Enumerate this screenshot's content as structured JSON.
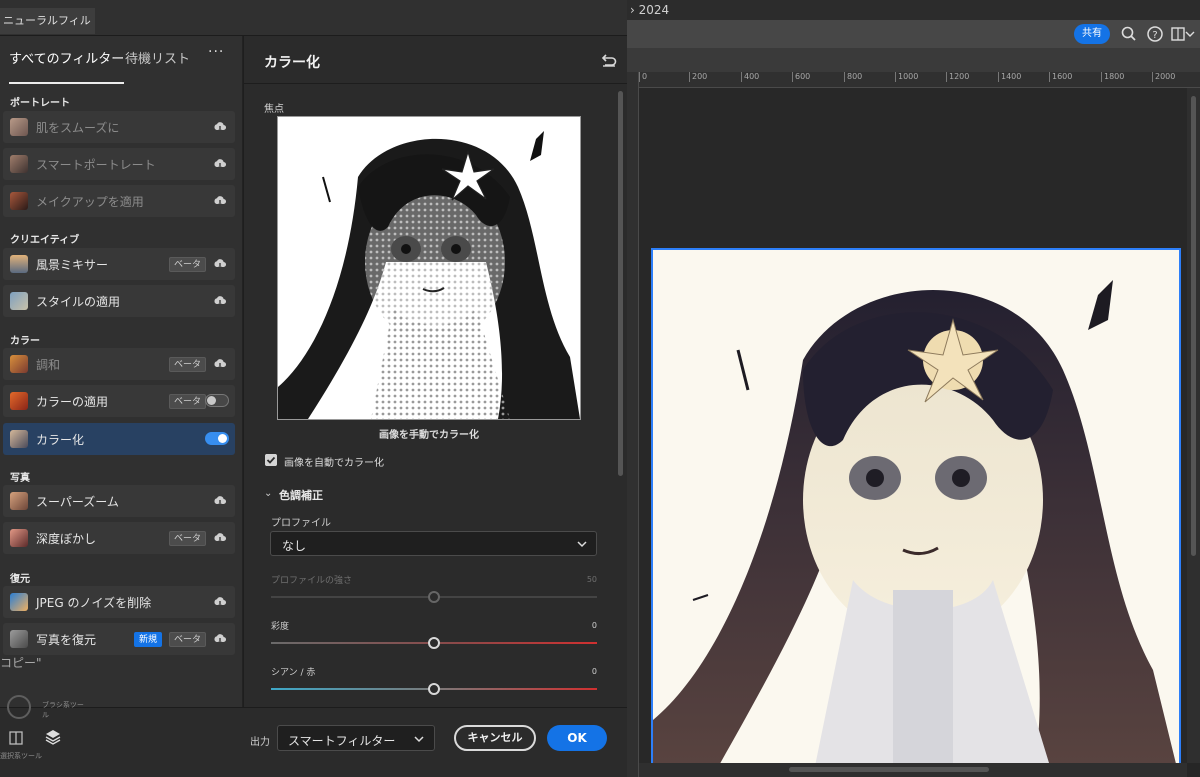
{
  "panel": {
    "tab_title": "ニューラルフィルター",
    "list_tabs": [
      "すべてのフィルター",
      "待機リスト"
    ],
    "more_label": "···"
  },
  "sections": [
    {
      "title": "ポートレート",
      "filters": [
        {
          "label": "肌をスムーズに",
          "dim": true,
          "badges": [],
          "control": "cloud"
        },
        {
          "label": "スマートポートレート",
          "dim": true,
          "badges": [],
          "control": "cloud"
        },
        {
          "label": "メイクアップを適用",
          "dim": true,
          "badges": [],
          "control": "cloud"
        }
      ]
    },
    {
      "title": "クリエイティブ",
      "filters": [
        {
          "label": "風景ミキサー",
          "dim": false,
          "badges": [
            "ベータ"
          ],
          "control": "cloud"
        },
        {
          "label": "スタイルの適用",
          "dim": false,
          "badges": [],
          "control": "cloud"
        }
      ]
    },
    {
      "title": "カラー",
      "filters": [
        {
          "label": "調和",
          "dim": true,
          "badges": [
            "ベータ"
          ],
          "control": "cloud"
        },
        {
          "label": "カラーの適用",
          "dim": false,
          "badges": [
            "ベータ"
          ],
          "control": "toggle-off"
        },
        {
          "label": "カラー化",
          "dim": false,
          "badges": [],
          "control": "toggle-on"
        }
      ]
    },
    {
      "title": "写真",
      "filters": [
        {
          "label": "スーパーズーム",
          "dim": false,
          "badges": [],
          "control": "cloud"
        },
        {
          "label": "深度ぼかし",
          "dim": false,
          "badges": [
            "ベータ"
          ],
          "control": "cloud"
        }
      ]
    },
    {
      "title": "復元",
      "filters": [
        {
          "label": "JPEG のノイズを削除",
          "dim": false,
          "badges": [],
          "control": "cloud"
        },
        {
          "label": "写真を復元",
          "dim": false,
          "badges": [
            "新規",
            "ベータ"
          ],
          "control": "cloud"
        }
      ]
    }
  ],
  "settings": {
    "title": "カラー化",
    "focus_label": "焦点",
    "manual_caption": "画像を手動でカラー化",
    "auto_label": "画像を自動でカラー化",
    "auto_checked": true,
    "tone_section": "色調補正",
    "profile_label": "プロファイル",
    "profile_value": "なし",
    "sliders": [
      {
        "label": "プロファイルの強さ",
        "value": "50",
        "level": 0.5,
        "dim": true
      },
      {
        "label": "彩度",
        "value": "0",
        "level": 0.5,
        "dim": false
      },
      {
        "label": "シアン / 赤",
        "value": "0",
        "level": 0.5,
        "dim": false
      }
    ]
  },
  "footer": {
    "output_label": "出力",
    "output_value": "スマートフィルター",
    "cancel_label": "キャンセル",
    "ok_label": "OK"
  },
  "ghost": {
    "copy_label": "コピー\"",
    "brush_tools": "ブラシ系ツール",
    "select_tools": "選択系ツール"
  },
  "photoshop": {
    "title_fragment": "2024",
    "share_label": "共有",
    "ruler_ticks": [
      "0",
      "200",
      "400",
      "600",
      "800",
      "1000",
      "1200",
      "1400",
      "1600",
      "1800",
      "2000"
    ]
  },
  "colors": {
    "accent": "#1473e6",
    "selection": "#284162",
    "canvas_border": "#2d7ff9"
  }
}
